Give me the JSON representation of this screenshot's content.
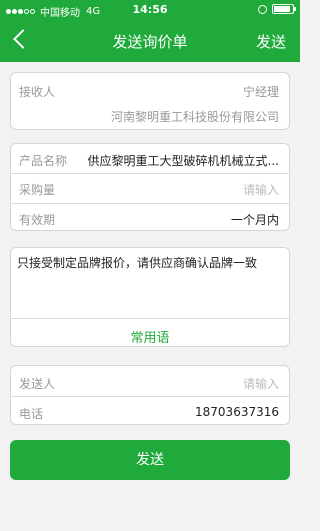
{
  "status_bar": {
    "carrier": "中国移动",
    "network": "4G",
    "time": "14:56",
    "battery_level": 0.9,
    "accent_color": "#1faa3b"
  },
  "nav": {
    "back_icon": "chevron-left-icon",
    "title": "发送询价单",
    "send_label": "发送"
  },
  "recipient": {
    "label": "接收人",
    "name": "宁经理",
    "company": "河南黎明重工科技股份有限公司"
  },
  "product": {
    "name_label": "产品名称",
    "name_value": "供应黎明重工大型破碎机机械立式...",
    "quantity_label": "采购量",
    "quantity_placeholder": "请输入",
    "validity_label": "有效期",
    "validity_value": "一个月内"
  },
  "message": {
    "text": "只接受制定品牌报价，请供应商确认品牌一致",
    "common_phrases_label": "常用语"
  },
  "sender": {
    "sender_label": "发送人",
    "sender_placeholder": "请输入",
    "phone_label": "电话",
    "phone_value": "18703637316"
  },
  "submit_label": "发送"
}
